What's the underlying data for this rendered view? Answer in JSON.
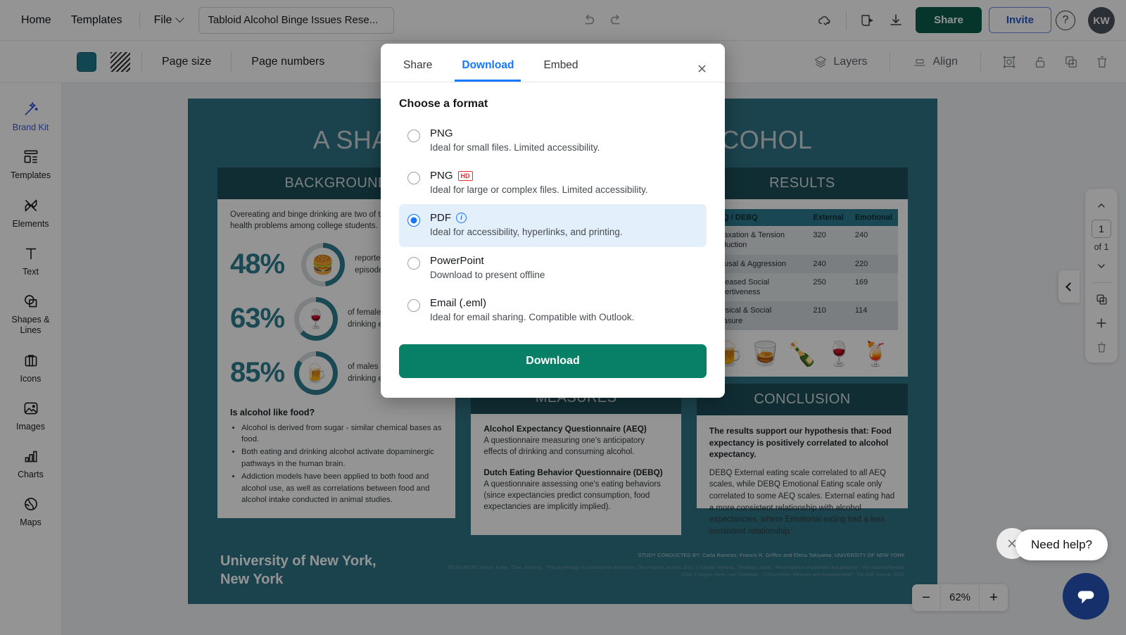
{
  "topbar": {
    "home": "Home",
    "templates": "Templates",
    "file": "File",
    "doc_title": "Tabloid Alcohol Binge Issues Rese...",
    "share_label": "Share",
    "invite_label": "Invite",
    "avatar_initials": "KW",
    "icons": {
      "undo": "undo-icon",
      "redo": "redo-icon",
      "cloud_saved": "cloud-saved-icon",
      "present": "present-icon",
      "download": "download-icon",
      "help": "?"
    },
    "colors": {
      "share_bg": "#0b5c4c",
      "invite_text": "#2558c8",
      "avatar_bg": "#4a525e"
    }
  },
  "toolbar2": {
    "page_size": "Page size",
    "page_numbers": "Page numbers",
    "layers": "Layers",
    "align": "Align",
    "swatch_color": "#1f7b8c"
  },
  "sidebar": {
    "items": [
      {
        "label": "Brand Kit",
        "icon": "magic-wand-icon"
      },
      {
        "label": "Templates",
        "icon": "templates-layout-icon"
      },
      {
        "label": "Elements",
        "icon": "elements-shapes-icon"
      },
      {
        "label": "Text",
        "icon": "text-t-icon"
      },
      {
        "label": "Shapes &\nLines",
        "icon": "shapes-lines-icon"
      },
      {
        "label": "Icons",
        "icon": "icons-grid-icon"
      },
      {
        "label": "Images",
        "icon": "image-picture-icon"
      },
      {
        "label": "Charts",
        "icon": "bar-chart-icon"
      },
      {
        "label": "Maps",
        "icon": "globe-map-icon"
      }
    ]
  },
  "modal": {
    "tabs": [
      {
        "label": "Share",
        "active": false
      },
      {
        "label": "Download",
        "active": true
      },
      {
        "label": "Embed",
        "active": false
      }
    ],
    "close_icon": "close-icon",
    "heading": "Choose a format",
    "options": [
      {
        "title": "PNG",
        "desc": "Ideal for small files. Limited accessibility.",
        "selected": false,
        "badge": "",
        "info": false
      },
      {
        "title": "PNG",
        "desc": "Ideal for large or complex files. Limited accessibility.",
        "selected": false,
        "badge": "HD",
        "info": false
      },
      {
        "title": "PDF",
        "desc": "Ideal for accessibility, hyperlinks, and printing.",
        "selected": true,
        "badge": "",
        "info": true
      },
      {
        "title": "PowerPoint",
        "desc": "Download to present offline",
        "selected": false,
        "badge": "",
        "info": false
      },
      {
        "title": "Email (.eml)",
        "desc": "Ideal for email sharing. Compatible with Outlook.",
        "selected": false,
        "badge": "",
        "info": false
      }
    ],
    "download_button": "Download",
    "colors": {
      "accent": "#1677ff",
      "selected_bg": "#e4effc",
      "download_bg": "#088068"
    }
  },
  "poster": {
    "title": "A SHARED PATHWAY: FOOD & ALCOHOL",
    "background": {
      "heading": "BACKGROUND",
      "intro": "Overeating and binge drinking are two of the most common health problems among college students.",
      "stats": [
        {
          "value": "48%",
          "emoji": "🍔",
          "text": "reported binge eating episodes.",
          "pct": 48
        },
        {
          "value": "63%",
          "emoji": "🍷",
          "text": "of females reported binge drinking episodes.",
          "pct": 63
        },
        {
          "value": "85%",
          "emoji": "🍺",
          "text": "of males reported binge drinking episodes.",
          "pct": 85
        }
      ],
      "question": "Is alcohol like food?",
      "bullets": [
        "Alcohol is derived from sugar - similar chemical bases as food.",
        "Both eating and drinking alcohol activate dopaminergic pathways in the human brain.",
        "Addiction models have been applied to both food and alcohol use, as well as correlations between food and alcohol intake conducted in animal studies."
      ]
    },
    "measures": {
      "heading": "MEASURES",
      "blocks": [
        {
          "title": "Alcohol Expectancy Questionnaire (AEQ)",
          "text": "A questionnaire measuring one's anticipatory effects of drinking and consuming alcohol."
        },
        {
          "title": "Dutch Eating Behavior Questionnaire (DEBQ)",
          "text": "A questionnaire assessing one's eating behaviors (since expectancies predict consumption, food expectancies are implicitly implied)."
        }
      ]
    },
    "results": {
      "heading": "RESULTS",
      "columns": [
        "AEQ / DEBQ",
        "External",
        "Emotional"
      ],
      "rows": [
        [
          "Relaxation & Tension Reduction",
          "320",
          "240"
        ],
        [
          "Arousal & Aggression",
          "240",
          "220"
        ],
        [
          "Increased Social Assertiveness",
          "250",
          "169"
        ],
        [
          "Physical & Social Pleasure",
          "210",
          "114"
        ]
      ],
      "beverages": [
        "🍺",
        "🥃",
        "🍾",
        "🍷",
        "🍹"
      ]
    },
    "conclusion": {
      "heading": "CONCLUSION",
      "bold": "The results support our hypothesis that: Food expectancy is positively correlated to alcohol expectancy.",
      "text": "DEBQ External eating scale correlated to all AEQ scales, while DEBQ Emotional Eating scale only correlated to some AEQ scales. External eating had a more consistent relationship with alcohol expectancies, where Emotional eating had a less consistent relationship."
    },
    "university": "University of New York,\nNew York",
    "study_credit": "STUDY CONDUCTED BY: Carla Ramirez, Francis R. Griffon and Elena Takiyama, UNIVERSITY OF NEW YORK",
    "resources": "RESOURCES: Walsh, Kathy., Chan, Anthony., \"The psychology of consumption and stress\" The Pearson Journal, 2017. // Satudo, Moriana., Temitope, Janet., \"Neuroscience of addiction and pleasure\", The Science Review, 2018. // Jurgen, Hans, Lee, Penelope., \"Consumption, Pleasure and Empowerment\", The Arch Journal, 2020."
  },
  "pagepanel": {
    "up_icon": "chevron-up-icon",
    "page_number": "1",
    "of_label": "of 1",
    "down_icon": "chevron-down-icon",
    "duplicate_icon": "duplicate-page-icon",
    "add_icon": "add-page-icon",
    "delete_icon": "delete-page-icon",
    "collapse_icon": "chevron-left-icon"
  },
  "zoom": {
    "minus": "−",
    "value": "62%",
    "plus": "+"
  },
  "helpwidget": {
    "close_icon": "close-icon",
    "label": "Need help?",
    "chat_icon": "chat-bubble-icon",
    "fab_color": "#16306b"
  }
}
